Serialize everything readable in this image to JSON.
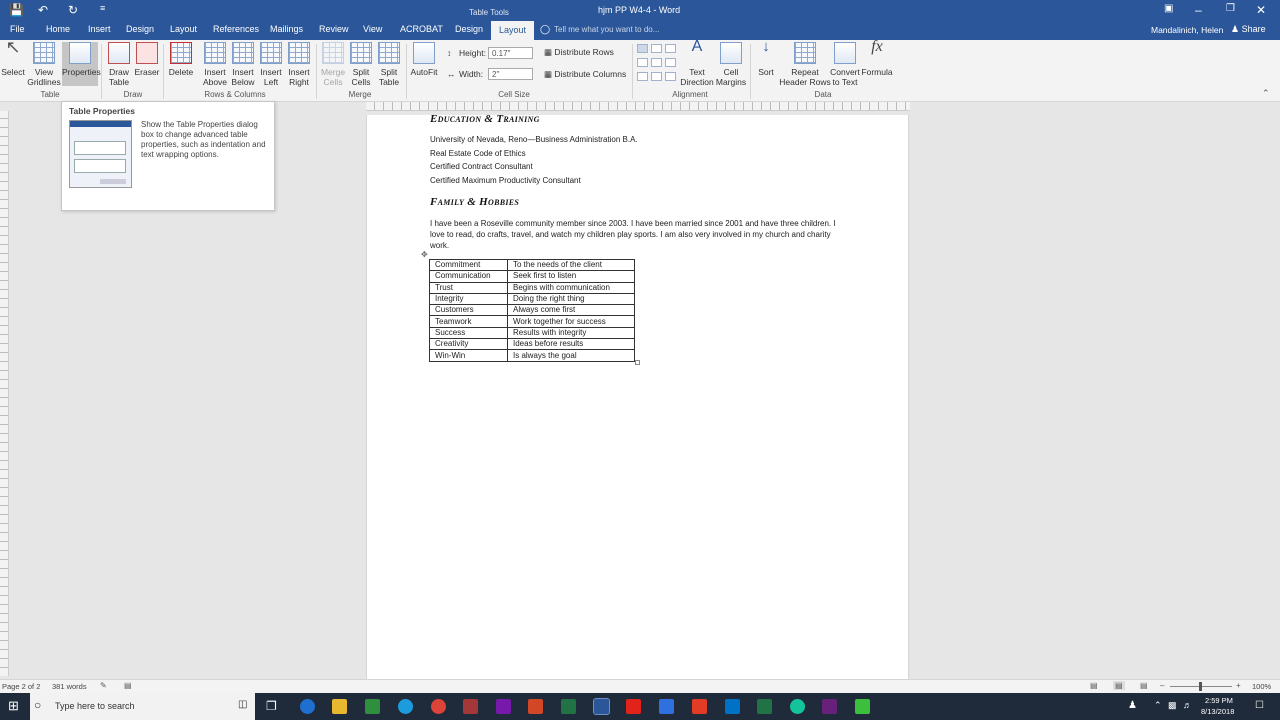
{
  "window": {
    "title": "hjm PP W4-4  -  Word",
    "contextual": "Table Tools"
  },
  "tabs": [
    "File",
    "Home",
    "Insert",
    "Design",
    "Layout",
    "References",
    "Mailings",
    "Review",
    "View",
    "ACROBAT",
    "Design",
    "Layout"
  ],
  "tell_me": "Tell me what you want to do...",
  "user": "Mandalinich, Helen",
  "share": "Share",
  "ribbon": {
    "select": "Select",
    "view_gridlines": [
      "View",
      "Gridlines"
    ],
    "properties": "Properties",
    "draw_table": [
      "Draw",
      "Table"
    ],
    "eraser": "Eraser",
    "delete": "Delete",
    "insert_above": [
      "Insert",
      "Above"
    ],
    "insert_below": [
      "Insert",
      "Below"
    ],
    "insert_left": [
      "Insert",
      "Left"
    ],
    "insert_right": [
      "Insert",
      "Right"
    ],
    "merge_cells": [
      "Merge",
      "Cells"
    ],
    "split_cells": [
      "Split",
      "Cells"
    ],
    "split_table": [
      "Split",
      "Table"
    ],
    "autofit": "AutoFit",
    "height_label": "Height:",
    "height_value": "0.17\"",
    "width_label": "Width:",
    "width_value": "2\"",
    "distribute_rows": "Distribute Rows",
    "distribute_columns": "Distribute Columns",
    "text_direction": [
      "Text",
      "Direction"
    ],
    "cell_margins": [
      "Cell",
      "Margins"
    ],
    "sort": "Sort",
    "repeat_header": [
      "Repeat",
      "Header Rows"
    ],
    "convert_text": [
      "Convert",
      "to Text"
    ],
    "formula": "Formula",
    "groups": [
      "Table",
      "Draw",
      "Rows & Columns",
      "Merge",
      "Cell Size",
      "Alignment",
      "Data"
    ]
  },
  "tooltip": {
    "title": "Table Properties",
    "desc": "Show the Table Properties dialog box to change advanced table properties, such as indentation and text wrapping options."
  },
  "document": {
    "heading1": "Education & Training",
    "edu": [
      "University of Nevada, Reno—Business Administration B.A.",
      "Real Estate Code of Ethics",
      "Certified Contract Consultant",
      "Certified Maximum Productivity Consultant"
    ],
    "heading2": "Family & Hobbies",
    "paragraph": "I have been a Roseville community member since 2003. I have been married since 2001 and have three children. I love to read, do crafts, travel, and watch my children play sports. I am also very involved in my church and charity work.",
    "table": [
      [
        "Commitment",
        "To the needs of the client"
      ],
      [
        "Communication",
        "Seek first to listen"
      ],
      [
        "Trust",
        "Begins with communication"
      ],
      [
        "Integrity",
        "Doing the right thing"
      ],
      [
        "Customers",
        "Always come first"
      ],
      [
        "Teamwork",
        "Work together for success"
      ],
      [
        "Success",
        "Results with integrity"
      ],
      [
        "Creativity",
        "Ideas before results"
      ],
      [
        "Win-Win",
        "Is always the goal"
      ]
    ]
  },
  "status": {
    "page": "Page 2 of 2",
    "words": "381 words",
    "zoom": "100%"
  },
  "taskbar": {
    "search": "Type here to search",
    "time": "2:59 PM",
    "date": "8/13/2018"
  }
}
